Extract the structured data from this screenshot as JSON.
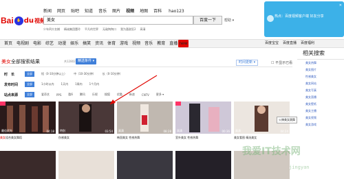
{
  "topnav": [
    "新闻",
    "网页",
    "贴吧",
    "知道",
    "音乐",
    "图片",
    "视频",
    "地图",
    "百科",
    "hao123"
  ],
  "logo": {
    "bai": "Bai",
    "du": "du",
    "shipin": "视频"
  },
  "search": {
    "query": "美女",
    "button": "百度一下",
    "more": "帮助 ▾"
  },
  "suggest": [
    "少年四大名捕",
    "精诚集团董玲",
    "平凡的世界",
    "无敌掏掏口",
    "我为喜剧狂2",
    "高清"
  ],
  "promo": {
    "text": "热点：百度视频客户端 好友分享",
    "close": "✕"
  },
  "categories": [
    "首页",
    "电视剧",
    "电影",
    "综艺",
    "动漫",
    "娱乐",
    "搞笑",
    "资讯",
    "体育",
    "游戏",
    "视频",
    "音乐",
    "教育",
    "直播"
  ],
  "right_nav": [
    "百度宝宝",
    "百度直播",
    "百度福利"
  ],
  "results": {
    "title_prefix": "美女",
    "title_suffix": "全部搜索结果",
    "count": "共1280246条",
    "filter_btn": "精选条件 ▾",
    "time_btn": "时间更新 ▾",
    "hide_watched": "☐ 不显示已看"
  },
  "filters": [
    {
      "label": "时　长",
      "options": [
        "全部",
        "短（0-10分钟以上）",
        "中（10-30分钟）",
        "长（0-10分钟）"
      ]
    },
    {
      "label": "发布时间",
      "options": [
        "全部",
        "1小时以内",
        "1天内",
        "1周内",
        "1个月内"
      ]
    },
    {
      "label": "站点来源",
      "options": [
        "全部",
        "爱奇艺",
        "PPS",
        "酷6",
        "腾讯",
        "乐视",
        "搜狐",
        "优酷",
        "新浪",
        "CNTV",
        "更多 ▾"
      ]
    }
  ],
  "thumbs": [
    {
      "tag": "最佳优先",
      "dur": "04:18",
      "bg": "#2a1a1a"
    },
    {
      "tag": "特别",
      "dur": "03:54",
      "bg": "#4a3838"
    },
    {
      "tag": "高清",
      "dur": "08:28",
      "bg": "#c0b8b0"
    },
    {
      "tag": "高清",
      "dur": "00:36",
      "bg": "#cfc8d8"
    },
    {
      "tag": "高清",
      "dur": "04:24",
      "bg": "#ece6e0"
    }
  ],
  "captions": [
    {
      "hl": "美女",
      "text": "组合美女舞蹈"
    },
    {
      "hl": "",
      "text": "伤感美女"
    },
    {
      "hl": "",
      "text": "韩国美女 性感热舞"
    },
    {
      "hl": "",
      "text": "室外美女 性感热舞"
    },
    {
      "hl": "",
      "text": "美女看图 精选美女"
    }
  ],
  "tooltip": "火辣美女跳舞",
  "right_panel": {
    "title": "相关搜索",
    "links": [
      "美女热舞",
      "美女图片",
      "性感美女",
      "美女网站",
      "美女写真",
      "美女直播",
      "美女壁纸",
      "美女主播",
      "美女视频",
      "美女游戏"
    ]
  },
  "watermark": {
    "main": "我爱IT技术网",
    "sub": "jingyan"
  },
  "colors": {
    "brand": "#e10601",
    "accent": "#3f7fd9",
    "promo": "#3cb1e8"
  }
}
